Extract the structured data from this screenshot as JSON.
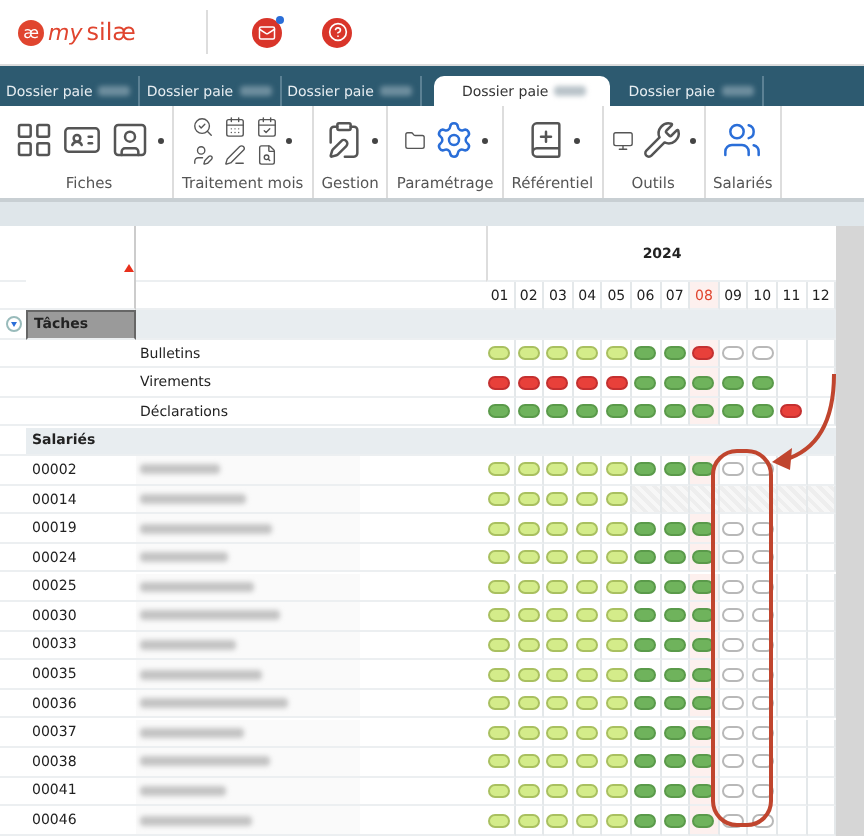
{
  "header": {
    "logo_mark": "æ",
    "logo_text": "my",
    "logo_brand": "silæ"
  },
  "tabs": [
    {
      "label": "Dossier paie",
      "selected": false
    },
    {
      "label": "Dossier paie",
      "selected": false
    },
    {
      "label": "Dossier paie",
      "selected": false
    },
    {
      "label": "Dossier paie",
      "selected": true
    },
    {
      "label": "Dossier paie",
      "selected": false
    }
  ],
  "ribbon": [
    {
      "label": "Fiches"
    },
    {
      "label": "Traitement mois"
    },
    {
      "label": "Gestion"
    },
    {
      "label": "Paramétrage"
    },
    {
      "label": "Référentiel"
    },
    {
      "label": "Outils"
    },
    {
      "label": "Salariés"
    }
  ],
  "grid": {
    "year": "2024",
    "months": [
      {
        "label": "01",
        "current": false
      },
      {
        "label": "02",
        "current": false
      },
      {
        "label": "03",
        "current": false
      },
      {
        "label": "04",
        "current": false
      },
      {
        "label": "05",
        "current": false
      },
      {
        "label": "06",
        "current": false
      },
      {
        "label": "07",
        "current": false
      },
      {
        "label": "08",
        "current": true
      },
      {
        "label": "09",
        "current": false
      },
      {
        "label": "10",
        "current": false
      },
      {
        "label": "11",
        "current": false
      },
      {
        "label": "12",
        "current": false
      }
    ],
    "tasks": {
      "label": "Tâches",
      "expanded": true,
      "rows": [
        {
          "label": "Bulletins",
          "cells": [
            {
              "kind": "pill",
              "color": "#d4ec8a"
            },
            {
              "kind": "pill",
              "color": "#d4ec8a"
            },
            {
              "kind": "pill",
              "color": "#d4ec8a"
            },
            {
              "kind": "pill",
              "color": "#d4ec8a"
            },
            {
              "kind": "pill",
              "color": "#d4ec8a"
            },
            {
              "kind": "pill",
              "color": "#6fb35c"
            },
            {
              "kind": "pill",
              "color": "#6fb35c"
            },
            {
              "kind": "pill",
              "color": "#e8403a"
            },
            {
              "kind": "pill",
              "color": "#ffffff"
            },
            {
              "kind": "pill",
              "color": "#ffffff"
            },
            {
              "kind": "blank"
            },
            {
              "kind": "blank"
            }
          ]
        },
        {
          "label": "Virements",
          "cells": [
            {
              "kind": "pill",
              "color": "#e8403a"
            },
            {
              "kind": "pill",
              "color": "#e8403a"
            },
            {
              "kind": "pill",
              "color": "#e8403a"
            },
            {
              "kind": "pill",
              "color": "#e8403a"
            },
            {
              "kind": "pill",
              "color": "#e8403a"
            },
            {
              "kind": "pill",
              "color": "#6fb35c"
            },
            {
              "kind": "pill",
              "color": "#6fb35c"
            },
            {
              "kind": "pill",
              "color": "#6fb35c"
            },
            {
              "kind": "pill",
              "color": "#6fb35c"
            },
            {
              "kind": "pill",
              "color": "#6fb35c"
            },
            {
              "kind": "blank"
            },
            {
              "kind": "blank"
            }
          ]
        },
        {
          "label": "Déclarations",
          "cells": [
            {
              "kind": "pill",
              "color": "#6fb35c"
            },
            {
              "kind": "pill",
              "color": "#6fb35c"
            },
            {
              "kind": "pill",
              "color": "#6fb35c"
            },
            {
              "kind": "pill",
              "color": "#6fb35c"
            },
            {
              "kind": "pill",
              "color": "#6fb35c"
            },
            {
              "kind": "pill",
              "color": "#6fb35c"
            },
            {
              "kind": "pill",
              "color": "#6fb35c"
            },
            {
              "kind": "pill",
              "color": "#6fb35c"
            },
            {
              "kind": "pill",
              "color": "#6fb35c"
            },
            {
              "kind": "pill",
              "color": "#6fb35c"
            },
            {
              "kind": "pill",
              "color": "#e8403a"
            },
            {
              "kind": "blank"
            }
          ]
        }
      ]
    },
    "employees": {
      "label": "Salariés",
      "rows": [
        {
          "code": "00002",
          "cells": [
            {
              "kind": "pill",
              "color": "#d4ec8a"
            },
            {
              "kind": "pill",
              "color": "#d4ec8a"
            },
            {
              "kind": "pill",
              "color": "#d4ec8a"
            },
            {
              "kind": "pill",
              "color": "#d4ec8a"
            },
            {
              "kind": "pill",
              "color": "#d4ec8a"
            },
            {
              "kind": "pill",
              "color": "#6fb35c"
            },
            {
              "kind": "pill",
              "color": "#6fb35c"
            },
            {
              "kind": "pill",
              "color": "#6fb35c"
            },
            {
              "kind": "pill",
              "color": "#ffffff"
            },
            {
              "kind": "pill",
              "color": "#ffffff"
            },
            {
              "kind": "blank"
            },
            {
              "kind": "blank"
            }
          ]
        },
        {
          "code": "00014",
          "cells": [
            {
              "kind": "pill",
              "color": "#d4ec8a"
            },
            {
              "kind": "pill",
              "color": "#d4ec8a"
            },
            {
              "kind": "pill",
              "color": "#d4ec8a"
            },
            {
              "kind": "pill",
              "color": "#d4ec8a"
            },
            {
              "kind": "pill",
              "color": "#d4ec8a"
            },
            {
              "kind": "blocked"
            },
            {
              "kind": "blocked"
            },
            {
              "kind": "blocked"
            },
            {
              "kind": "blocked"
            },
            {
              "kind": "blocked"
            },
            {
              "kind": "blocked"
            },
            {
              "kind": "blocked"
            }
          ]
        },
        {
          "code": "00019",
          "cells": [
            {
              "kind": "pill",
              "color": "#d4ec8a"
            },
            {
              "kind": "pill",
              "color": "#d4ec8a"
            },
            {
              "kind": "pill",
              "color": "#d4ec8a"
            },
            {
              "kind": "pill",
              "color": "#d4ec8a"
            },
            {
              "kind": "pill",
              "color": "#d4ec8a"
            },
            {
              "kind": "pill",
              "color": "#6fb35c"
            },
            {
              "kind": "pill",
              "color": "#6fb35c"
            },
            {
              "kind": "pill",
              "color": "#6fb35c"
            },
            {
              "kind": "pill",
              "color": "#ffffff"
            },
            {
              "kind": "pill",
              "color": "#ffffff"
            },
            {
              "kind": "blank"
            },
            {
              "kind": "blank"
            }
          ]
        },
        {
          "code": "00024",
          "cells": [
            {
              "kind": "pill",
              "color": "#d4ec8a"
            },
            {
              "kind": "pill",
              "color": "#d4ec8a"
            },
            {
              "kind": "pill",
              "color": "#d4ec8a"
            },
            {
              "kind": "pill",
              "color": "#d4ec8a"
            },
            {
              "kind": "pill",
              "color": "#d4ec8a"
            },
            {
              "kind": "pill",
              "color": "#6fb35c"
            },
            {
              "kind": "pill",
              "color": "#6fb35c"
            },
            {
              "kind": "pill",
              "color": "#6fb35c"
            },
            {
              "kind": "pill",
              "color": "#ffffff"
            },
            {
              "kind": "pill",
              "color": "#ffffff"
            },
            {
              "kind": "blank"
            },
            {
              "kind": "blank"
            }
          ]
        },
        {
          "code": "00025",
          "cells": [
            {
              "kind": "pill",
              "color": "#d4ec8a"
            },
            {
              "kind": "pill",
              "color": "#d4ec8a"
            },
            {
              "kind": "pill",
              "color": "#d4ec8a"
            },
            {
              "kind": "pill",
              "color": "#d4ec8a"
            },
            {
              "kind": "pill",
              "color": "#d4ec8a"
            },
            {
              "kind": "pill",
              "color": "#6fb35c"
            },
            {
              "kind": "pill",
              "color": "#6fb35c"
            },
            {
              "kind": "pill",
              "color": "#6fb35c"
            },
            {
              "kind": "pill",
              "color": "#ffffff"
            },
            {
              "kind": "pill",
              "color": "#ffffff"
            },
            {
              "kind": "blank"
            },
            {
              "kind": "blank"
            }
          ]
        },
        {
          "code": "00030",
          "cells": [
            {
              "kind": "pill",
              "color": "#d4ec8a"
            },
            {
              "kind": "pill",
              "color": "#d4ec8a"
            },
            {
              "kind": "pill",
              "color": "#d4ec8a"
            },
            {
              "kind": "pill",
              "color": "#d4ec8a"
            },
            {
              "kind": "pill",
              "color": "#d4ec8a"
            },
            {
              "kind": "pill",
              "color": "#6fb35c"
            },
            {
              "kind": "pill",
              "color": "#6fb35c"
            },
            {
              "kind": "pill",
              "color": "#6fb35c"
            },
            {
              "kind": "pill",
              "color": "#ffffff"
            },
            {
              "kind": "pill",
              "color": "#ffffff"
            },
            {
              "kind": "blank"
            },
            {
              "kind": "blank"
            }
          ]
        },
        {
          "code": "00033",
          "cells": [
            {
              "kind": "pill",
              "color": "#d4ec8a"
            },
            {
              "kind": "pill",
              "color": "#d4ec8a"
            },
            {
              "kind": "pill",
              "color": "#d4ec8a"
            },
            {
              "kind": "pill",
              "color": "#d4ec8a"
            },
            {
              "kind": "pill",
              "color": "#d4ec8a"
            },
            {
              "kind": "pill",
              "color": "#6fb35c"
            },
            {
              "kind": "pill",
              "color": "#6fb35c"
            },
            {
              "kind": "pill",
              "color": "#6fb35c"
            },
            {
              "kind": "pill",
              "color": "#ffffff"
            },
            {
              "kind": "pill",
              "color": "#ffffff"
            },
            {
              "kind": "blank"
            },
            {
              "kind": "blank"
            }
          ]
        },
        {
          "code": "00035",
          "cells": [
            {
              "kind": "pill",
              "color": "#d4ec8a"
            },
            {
              "kind": "pill",
              "color": "#d4ec8a"
            },
            {
              "kind": "pill",
              "color": "#d4ec8a"
            },
            {
              "kind": "pill",
              "color": "#d4ec8a"
            },
            {
              "kind": "pill",
              "color": "#d4ec8a"
            },
            {
              "kind": "pill",
              "color": "#6fb35c"
            },
            {
              "kind": "pill",
              "color": "#6fb35c"
            },
            {
              "kind": "pill",
              "color": "#6fb35c"
            },
            {
              "kind": "pill",
              "color": "#ffffff"
            },
            {
              "kind": "pill",
              "color": "#ffffff"
            },
            {
              "kind": "blank"
            },
            {
              "kind": "blank"
            }
          ]
        },
        {
          "code": "00036",
          "cells": [
            {
              "kind": "pill",
              "color": "#d4ec8a"
            },
            {
              "kind": "pill",
              "color": "#d4ec8a"
            },
            {
              "kind": "pill",
              "color": "#d4ec8a"
            },
            {
              "kind": "pill",
              "color": "#d4ec8a"
            },
            {
              "kind": "pill",
              "color": "#d4ec8a"
            },
            {
              "kind": "pill",
              "color": "#6fb35c"
            },
            {
              "kind": "pill",
              "color": "#6fb35c"
            },
            {
              "kind": "pill",
              "color": "#6fb35c"
            },
            {
              "kind": "pill",
              "color": "#ffffff"
            },
            {
              "kind": "pill",
              "color": "#ffffff"
            },
            {
              "kind": "blank"
            },
            {
              "kind": "blank"
            }
          ]
        },
        {
          "code": "00037",
          "cells": [
            {
              "kind": "pill",
              "color": "#d4ec8a"
            },
            {
              "kind": "pill",
              "color": "#d4ec8a"
            },
            {
              "kind": "pill",
              "color": "#d4ec8a"
            },
            {
              "kind": "pill",
              "color": "#d4ec8a"
            },
            {
              "kind": "pill",
              "color": "#d4ec8a"
            },
            {
              "kind": "pill",
              "color": "#6fb35c"
            },
            {
              "kind": "pill",
              "color": "#6fb35c"
            },
            {
              "kind": "pill",
              "color": "#6fb35c"
            },
            {
              "kind": "pill",
              "color": "#ffffff"
            },
            {
              "kind": "pill",
              "color": "#ffffff"
            },
            {
              "kind": "blank"
            },
            {
              "kind": "blank"
            }
          ]
        },
        {
          "code": "00038",
          "cells": [
            {
              "kind": "pill",
              "color": "#d4ec8a"
            },
            {
              "kind": "pill",
              "color": "#d4ec8a"
            },
            {
              "kind": "pill",
              "color": "#d4ec8a"
            },
            {
              "kind": "pill",
              "color": "#d4ec8a"
            },
            {
              "kind": "pill",
              "color": "#d4ec8a"
            },
            {
              "kind": "pill",
              "color": "#6fb35c"
            },
            {
              "kind": "pill",
              "color": "#6fb35c"
            },
            {
              "kind": "pill",
              "color": "#6fb35c"
            },
            {
              "kind": "pill",
              "color": "#ffffff"
            },
            {
              "kind": "pill",
              "color": "#ffffff"
            },
            {
              "kind": "blank"
            },
            {
              "kind": "blank"
            }
          ]
        },
        {
          "code": "00041",
          "cells": [
            {
              "kind": "pill",
              "color": "#d4ec8a"
            },
            {
              "kind": "pill",
              "color": "#d4ec8a"
            },
            {
              "kind": "pill",
              "color": "#d4ec8a"
            },
            {
              "kind": "pill",
              "color": "#d4ec8a"
            },
            {
              "kind": "pill",
              "color": "#d4ec8a"
            },
            {
              "kind": "pill",
              "color": "#6fb35c"
            },
            {
              "kind": "pill",
              "color": "#6fb35c"
            },
            {
              "kind": "pill",
              "color": "#6fb35c"
            },
            {
              "kind": "pill",
              "color": "#ffffff"
            },
            {
              "kind": "pill",
              "color": "#ffffff"
            },
            {
              "kind": "blank"
            },
            {
              "kind": "blank"
            }
          ]
        },
        {
          "code": "00046",
          "cells": [
            {
              "kind": "pill",
              "color": "#d4ec8a"
            },
            {
              "kind": "pill",
              "color": "#d4ec8a"
            },
            {
              "kind": "pill",
              "color": "#d4ec8a"
            },
            {
              "kind": "pill",
              "color": "#d4ec8a"
            },
            {
              "kind": "pill",
              "color": "#d4ec8a"
            },
            {
              "kind": "pill",
              "color": "#6fb35c"
            },
            {
              "kind": "pill",
              "color": "#6fb35c"
            },
            {
              "kind": "pill",
              "color": "#6fb35c"
            },
            {
              "kind": "pill",
              "color": "#ffffff"
            },
            {
              "kind": "pill",
              "color": "#ffffff"
            },
            {
              "kind": "blank"
            },
            {
              "kind": "blank"
            }
          ]
        }
      ]
    }
  }
}
